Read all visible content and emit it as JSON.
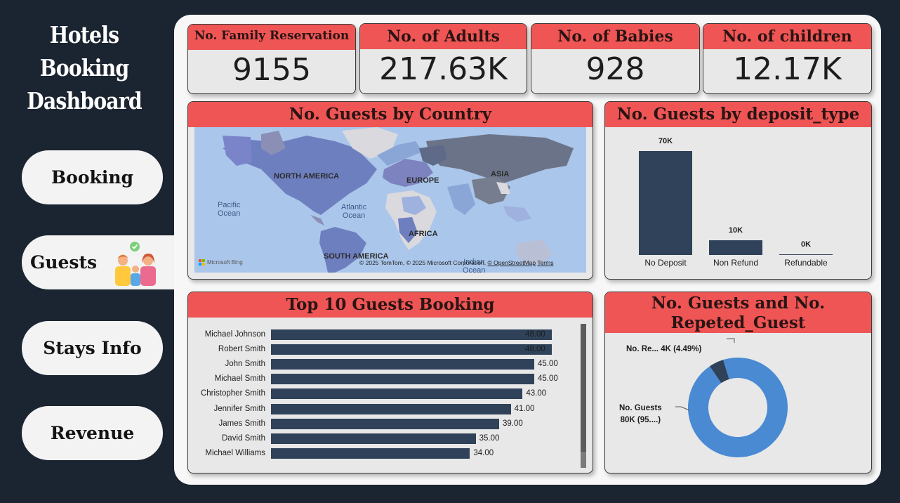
{
  "sidebar": {
    "title_lines": [
      "Hotels",
      "Booking",
      "Dashboard"
    ],
    "nav": [
      {
        "label": "Booking"
      },
      {
        "label": "Guests",
        "active": true
      },
      {
        "label": "Stays Info"
      },
      {
        "label": "Revenue"
      }
    ]
  },
  "kpis": [
    {
      "title": "No. Family Reservation",
      "value": "9155"
    },
    {
      "title": "No. of Adults",
      "value": "217.63K"
    },
    {
      "title": "No. of Babies",
      "value": "928"
    },
    {
      "title": "No. of children",
      "value": "12.17K"
    }
  ],
  "map": {
    "title": "No. Guests by Country",
    "labels": {
      "north_america": "NORTH AMERICA",
      "europe": "EUROPE",
      "asia": "ASIA",
      "africa": "AFRICA",
      "south_america": "SOUTH AMERICA",
      "pacific": "Pacific\nOcean",
      "atlantic": "Atlantic\nOcean",
      "indian": "Indian\nOcean"
    },
    "credit": "© 2025 TomTom, © 2025 Microsoft Corporation,",
    "credit_link": "© OpenStreetMap",
    "credit_terms": "Terms",
    "bing": "Microsoft Bing"
  },
  "colors": {
    "accent": "#ef5554",
    "bar": "#2f4259",
    "donut_main": "#4a8ad3",
    "donut_small": "#2f4259",
    "sidebar_bg": "#1b2431"
  },
  "chart_data": [
    {
      "type": "bar",
      "title": "No. Guests by deposit_type",
      "categories": [
        "No Deposit",
        "Non Refund",
        "Refundable"
      ],
      "values": [
        70000,
        10000,
        200
      ],
      "data_labels": [
        "70K",
        "10K",
        "0K"
      ]
    },
    {
      "type": "bar",
      "orientation": "horizontal",
      "title": "Top 10 Guests Booking",
      "categories": [
        "Michael Johnson",
        "Robert Smith",
        "John Smith",
        "Michael Smith",
        "Christopher Smith",
        "Jennifer Smith",
        "James Smith",
        "David Smith",
        "Michael Williams"
      ],
      "values": [
        48,
        48,
        45,
        45,
        43,
        41,
        39,
        35,
        34
      ],
      "data_labels": [
        "48.00",
        "48.00",
        "45.00",
        "45.00",
        "43.00",
        "41.00",
        "39.00",
        "35.00",
        "34.00"
      ]
    },
    {
      "type": "pie",
      "title": "No. Guests and No. Repeted_Guest",
      "categories": [
        "No. Guests",
        "No. Re..."
      ],
      "values": [
        80000,
        4000
      ],
      "data_labels": [
        "No. Guests\n80K (95....)",
        "No. Re... 4K (4.49%)"
      ]
    }
  ]
}
